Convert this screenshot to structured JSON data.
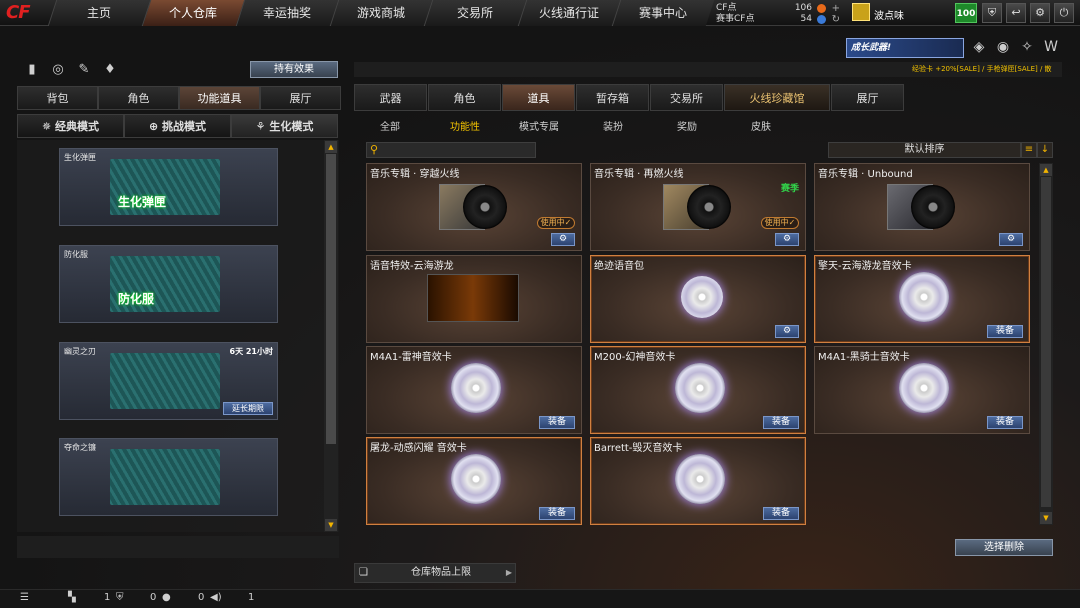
{
  "nav": {
    "logo": "CF",
    "tabs": [
      "主页",
      "个人仓库",
      "幸运抽奖",
      "游戏商城",
      "交易所",
      "火线通行证",
      "赛事中心"
    ],
    "active_index": 1
  },
  "account": {
    "cf_label": "CF点",
    "cf_value": "106",
    "event_label": "赛事CF点",
    "event_value": "54",
    "username": "波点味",
    "level": "100"
  },
  "left": {
    "effect_button": "持有效果",
    "tabs": [
      "背包",
      "角色",
      "功能道具",
      "展厅"
    ],
    "active_tab": 2,
    "modes": [
      "经典模式",
      "挑战模式",
      "生化模式"
    ],
    "active_mode": 2,
    "items": [
      {
        "name": "生化弹匣",
        "art_label": "生化弹匣",
        "time": "",
        "button": ""
      },
      {
        "name": "防化服",
        "art_label": "防化服",
        "time": "",
        "button": ""
      },
      {
        "name": "幽灵之刃",
        "art_label": "",
        "time": "6天 21小时",
        "button": "延长期限"
      },
      {
        "name": "夺命之镰",
        "art_label": "",
        "time": "",
        "button": ""
      }
    ]
  },
  "banner": {
    "text": "成长武器!",
    "sale_line": "经验卡 +20%[SALE] / 手枪弹匣[SALE] / 散"
  },
  "right": {
    "tabs": [
      "武器",
      "角色",
      "道具",
      "暂存箱",
      "交易所",
      "火线珍藏馆",
      "展厅"
    ],
    "active_tab": 2,
    "subtabs": [
      "全部",
      "功能性",
      "模式专属",
      "装扮",
      "奖励",
      "皮肤"
    ],
    "active_subtab": 1,
    "search_placeholder": "",
    "sort_label": "默认排序",
    "cards": [
      {
        "title": "音乐专辑 · 穿越火线",
        "type": "album",
        "tag": "",
        "in_use": "使用中✓",
        "action": "gear"
      },
      {
        "title": "音乐专辑 · 再燃火线",
        "type": "album",
        "tag": "赛季",
        "in_use": "使用中✓",
        "action": "gear"
      },
      {
        "title": "音乐专辑 · Unbound",
        "type": "album",
        "tag": "",
        "in_use": "",
        "action": "gear"
      },
      {
        "title": "语音特效-云海游龙",
        "type": "wave",
        "tag": "",
        "in_use": "",
        "action": ""
      },
      {
        "title": "绝迹语音包",
        "type": "voice",
        "tag": "",
        "in_use": "",
        "action": "gear"
      },
      {
        "title": "擎天-云海游龙音效卡",
        "type": "disc",
        "tag": "",
        "in_use": "",
        "action": "装备"
      },
      {
        "title": "M4A1-雷神音效卡",
        "type": "disc",
        "tag": "",
        "in_use": "",
        "action": "装备"
      },
      {
        "title": "M200-幻神音效卡",
        "type": "disc",
        "tag": "",
        "in_use": "",
        "action": "装备"
      },
      {
        "title": "M4A1-黑骑士音效卡",
        "type": "disc",
        "tag": "",
        "in_use": "",
        "action": "装备"
      },
      {
        "title": "屠龙-动感闪耀 音效卡",
        "type": "disc",
        "tag": "",
        "in_use": "",
        "action": "装备"
      },
      {
        "title": "Barrett-毁灭音效卡",
        "type": "disc",
        "tag": "",
        "in_use": "",
        "action": "装备"
      }
    ],
    "select_delete": "选择删除",
    "storage_label": "仓库物品上限"
  },
  "status": {
    "a": "1",
    "b": "0",
    "c": "0",
    "d": "1"
  },
  "colors": {
    "accent": "#f2c200",
    "active_tab": "#6a4a38",
    "button_blue": "#4d6ca0",
    "highlight_border": "#d08040",
    "tag_green": "#32d24a"
  }
}
